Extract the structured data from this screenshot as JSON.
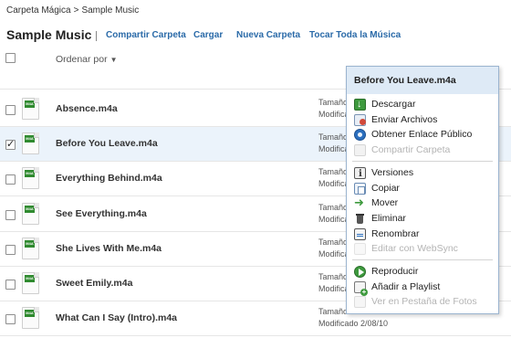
{
  "breadcrumb": {
    "parent": "Carpeta Mágica",
    "separator": ">",
    "current": "Sample Music"
  },
  "header": {
    "title": "Sample Music",
    "actions": [
      "Compartir Carpeta",
      "Cargar",
      "Nueva Carpeta",
      "Tocar Toda la Música"
    ]
  },
  "list": {
    "sort_label": "Ordenar por",
    "sort_caret": "▼",
    "icon_badge": "M4A",
    "files": [
      {
        "name": "Absence.m4a",
        "size_label": "Tamaño",
        "modified_label": "Modifica",
        "checked": false
      },
      {
        "name": "Before You Leave.m4a",
        "size_label": "Tamaño",
        "modified_label": "Modifica",
        "checked": true
      },
      {
        "name": "Everything Behind.m4a",
        "size_label": "Tamaño",
        "modified_label": "Modifica",
        "checked": false
      },
      {
        "name": "See Everything.m4a",
        "size_label": "Tamaño",
        "modified_label": "Modifica",
        "checked": false
      },
      {
        "name": "She Lives With Me.m4a",
        "size_label": "Tamaño",
        "modified_label": "Modifica",
        "checked": false
      },
      {
        "name": "Sweet Emily.m4a",
        "size_label": "Tamaño",
        "modified_label": "Modifica",
        "checked": false
      },
      {
        "name": "What Can I Say (Intro).m4a",
        "size_label": "Tamaño 3.4 KB",
        "modified_label": "Modificado 2/08/10",
        "checked": false
      }
    ]
  },
  "context_menu": {
    "title": "Before You Leave.m4a",
    "groups": [
      [
        {
          "label": "Descargar",
          "icon": "download-icon",
          "enabled": true
        },
        {
          "label": "Enviar Archivos",
          "icon": "send-files-icon",
          "enabled": true
        },
        {
          "label": "Obtener Enlace Público",
          "icon": "public-link-icon",
          "enabled": true
        },
        {
          "label": "Compartir Carpeta",
          "icon": "share-folder-icon",
          "enabled": false
        }
      ],
      [
        {
          "label": "Versiones",
          "icon": "versions-icon",
          "enabled": true
        },
        {
          "label": "Copiar",
          "icon": "copy-icon",
          "enabled": true
        },
        {
          "label": "Mover",
          "icon": "move-icon",
          "enabled": true
        },
        {
          "label": "Eliminar",
          "icon": "delete-icon",
          "enabled": true
        },
        {
          "label": "Renombrar",
          "icon": "rename-icon",
          "enabled": true
        },
        {
          "label": "Editar con WebSync",
          "icon": "websync-icon",
          "enabled": false
        }
      ],
      [
        {
          "label": "Reproducir",
          "icon": "play-icon",
          "enabled": true
        },
        {
          "label": "Añadir a Playlist",
          "icon": "add-playlist-icon",
          "enabled": true
        },
        {
          "label": "Ver en Pestaña de Fotos",
          "icon": "photos-tab-icon",
          "enabled": false
        }
      ]
    ]
  },
  "colors": {
    "link": "#2a6aa8",
    "selected_row": "#ebf3fb",
    "menu_header": "#deeaf6",
    "disabled_text": "#b4b4b4"
  }
}
